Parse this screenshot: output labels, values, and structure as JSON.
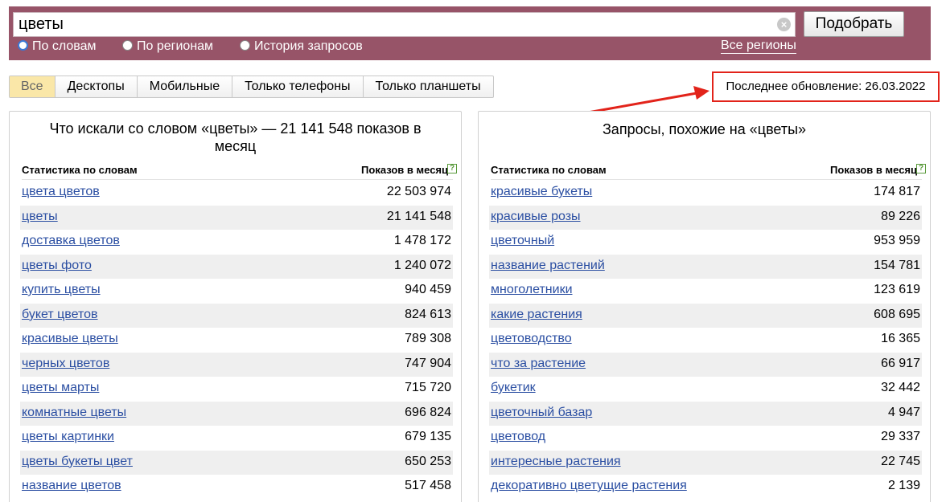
{
  "search": {
    "query": "цветы",
    "submit_label": "Подобрать"
  },
  "modes": [
    {
      "label": "По словам",
      "checked": true
    },
    {
      "label": "По регионам",
      "checked": false
    },
    {
      "label": "История запросов",
      "checked": false
    }
  ],
  "regions_link": "Все регионы",
  "device_tabs": [
    "Все",
    "Десктопы",
    "Мобильные",
    "Только телефоны",
    "Только планшеты"
  ],
  "active_tab": "Все",
  "update_note": "Последнее обновление: 26.03.2022",
  "colors": {
    "header": "#975468",
    "link": "#2a4ea2",
    "highlight_border": "#e2231a",
    "active_tab": "#fae7a8"
  },
  "left_panel": {
    "title": "Что искали со словом «цветы» — 21 141 548 показов в месяц",
    "col_word": "Статистика по словам",
    "col_count": "Показов в месяц",
    "rows": [
      {
        "word": "цвета цветов",
        "count": "22 503 974"
      },
      {
        "word": "цветы",
        "count": "21 141 548"
      },
      {
        "word": "доставка цветов",
        "count": "1 478 172"
      },
      {
        "word": "цветы фото",
        "count": "1 240 072"
      },
      {
        "word": "купить цветы",
        "count": "940 459"
      },
      {
        "word": "букет цветов",
        "count": "824 613"
      },
      {
        "word": "красивые цветы",
        "count": "789 308"
      },
      {
        "word": "черных цветов",
        "count": "747 904"
      },
      {
        "word": "цветы марты",
        "count": "715 720"
      },
      {
        "word": "комнатные цветы",
        "count": "696 824"
      },
      {
        "word": "цветы картинки",
        "count": "679 135"
      },
      {
        "word": "цветы букеты цвет",
        "count": "650 253"
      },
      {
        "word": "название цветов",
        "count": "517 458"
      }
    ]
  },
  "right_panel": {
    "title": "Запросы, похожие на «цветы»",
    "col_word": "Статистика по словам",
    "col_count": "Показов в месяц",
    "rows": [
      {
        "word": "красивые букеты",
        "count": "174 817"
      },
      {
        "word": "красивые розы",
        "count": "89 226"
      },
      {
        "word": "цветочный",
        "count": "953 959"
      },
      {
        "word": "название растений",
        "count": "154 781"
      },
      {
        "word": "многолетники",
        "count": "123 619"
      },
      {
        "word": "какие растения",
        "count": "608 695"
      },
      {
        "word": "цветоводство",
        "count": "16 365"
      },
      {
        "word": "что за растение",
        "count": "66 917"
      },
      {
        "word": "букетик",
        "count": "32 442"
      },
      {
        "word": "цветочный базар",
        "count": "4 947"
      },
      {
        "word": "цветовод",
        "count": "29 337"
      },
      {
        "word": "интересные растения",
        "count": "22 745"
      },
      {
        "word": "декоративно цветущие растения",
        "count": "2 139"
      }
    ]
  }
}
